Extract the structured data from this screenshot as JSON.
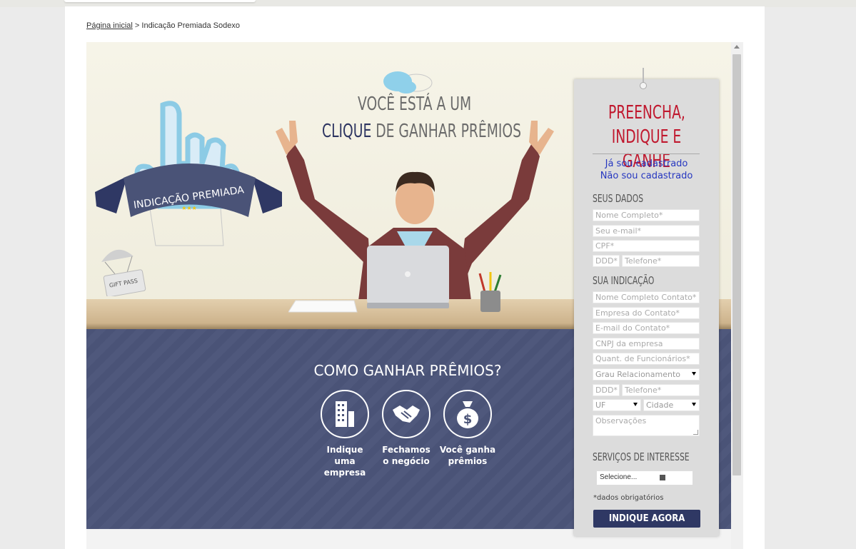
{
  "breadcrumb": {
    "home": "Página inicial",
    "separator": ">",
    "current": "Indicação Premiada Sodexo"
  },
  "hero": {
    "headline_line1": "VOCÊ ESTÁ A UM",
    "headline_highlight": "CLIQUE",
    "headline_rest": " DE GANHAR PRÊMIOS",
    "badge_text": "INDICAÇÃO PREMIADA",
    "badge_stars": "★★★",
    "gift_text": "GIFT PASS"
  },
  "how": {
    "title": "COMO GANHAR PRÊMIOS?",
    "steps": [
      {
        "line1": "Indique",
        "line2": "uma empresa",
        "icon": "building-icon"
      },
      {
        "line1": "Fechamos",
        "line2": "o negócio",
        "icon": "handshake-icon"
      },
      {
        "line1": "Você ganha",
        "line2": "prêmios",
        "icon": "money-bag-icon"
      }
    ]
  },
  "form": {
    "title_line1": "PREENCHA,",
    "title_line2": "INDIQUE E GANHE",
    "link_registered": "Já sou cadastrado",
    "link_not_registered": "Não sou cadastrado",
    "section_yours": "SEUS DADOS",
    "section_referral": "SUA INDICAÇÃO",
    "section_services": "SERVIÇOS DE INTERESSE",
    "ph_name": "Nome Completo*",
    "ph_email": "Seu e-mail*",
    "ph_cpf": "CPF*",
    "ph_ddd": "DDD*",
    "ph_phone": "Telefone*",
    "ph_contact_name": "Nome Completo Contato*",
    "ph_contact_company": "Empresa do Contato*",
    "ph_contact_email": "E-mail do Contato*",
    "ph_cnpj": "CNPJ da empresa",
    "ph_employees": "Quant. de Funcionários*",
    "sel_relationship": "Grau Relacionamento",
    "ph_ddd2": "DDD*",
    "ph_phone2": "Telefone*",
    "sel_uf": "UF",
    "sel_city": "Cidade",
    "ph_notes": "Observações",
    "sel_services": "Selecione...",
    "required_note": "*dados obrigatórios",
    "submit": "INDIQUE AGORA"
  },
  "colors": {
    "navy": "#2f3864",
    "red": "#c0182e",
    "link": "#2637c0",
    "panel": "#dcdcdc"
  }
}
